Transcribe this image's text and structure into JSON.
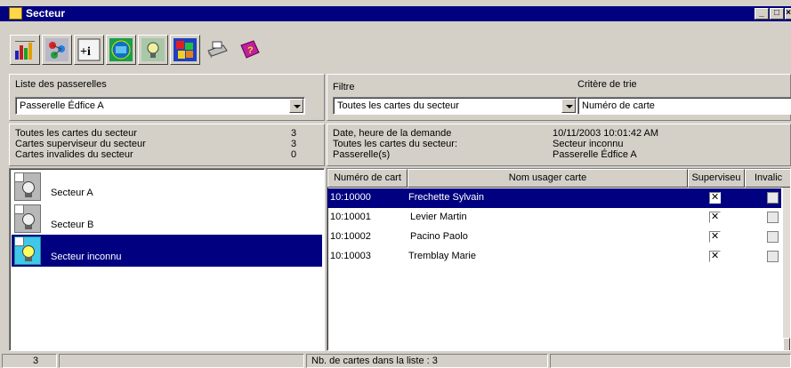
{
  "window": {
    "title": "Secteur",
    "controls": [
      "_",
      "□",
      "×"
    ]
  },
  "toolbar": {
    "buttons": [
      {
        "icon": "bar-chart-icon"
      },
      {
        "icon": "network-icon"
      },
      {
        "icon": "add-info-icon"
      },
      {
        "icon": "id-card-icon"
      },
      {
        "icon": "bulb-sector-icon"
      },
      {
        "icon": "map-icon"
      },
      {
        "icon": "printer-icon"
      },
      {
        "icon": "help-book-icon"
      }
    ]
  },
  "gateways": {
    "label": "Liste des passerelles",
    "selected": "Passerelle Édfice A"
  },
  "filter": {
    "label": "Filtre",
    "selected": "Toutes les cartes du secteur",
    "sort_label": "Critère de trie",
    "sort_selected": "Numéro de carte"
  },
  "sector_stats": [
    {
      "label": "Toutes les cartes du secteur",
      "value": "3"
    },
    {
      "label": "Cartes superviseur du secteur",
      "value": "3"
    },
    {
      "label": "Cartes invalides du secteur",
      "value": "0"
    }
  ],
  "request_info": [
    {
      "label": "Date, heure de la demande",
      "value": "10/11/2003 10:01:42 AM"
    },
    {
      "label": "Toutes les cartes du secteur:",
      "value": "Secteur inconnu"
    },
    {
      "label": "Passerelle(s)",
      "value": "Passerelle Édfice A"
    }
  ],
  "sectors": [
    {
      "name": "Secteur A",
      "selected": false
    },
    {
      "name": "Secteur B",
      "selected": false
    },
    {
      "name": "Secteur inconnu",
      "selected": true
    }
  ],
  "grid": {
    "columns": [
      "Numéro de cart",
      "Nom usager carte",
      "Superviseu",
      "Invalic"
    ],
    "rows": [
      {
        "number": "10:10000",
        "name": "Frechette Sylvain",
        "supervisor": true,
        "invalid": false,
        "selected": true
      },
      {
        "number": "10:10001",
        "name": "Levier  Martin",
        "supervisor": true,
        "invalid": false,
        "selected": false
      },
      {
        "number": "10:10002",
        "name": "Pacino Paolo",
        "supervisor": true,
        "invalid": false,
        "selected": false
      },
      {
        "number": "10:10003",
        "name": "Tremblay  Marie",
        "supervisor": true,
        "invalid": false,
        "selected": false
      }
    ]
  },
  "status": {
    "count": "3",
    "cards_in_list": "Nb. de cartes dans la liste : 3"
  }
}
